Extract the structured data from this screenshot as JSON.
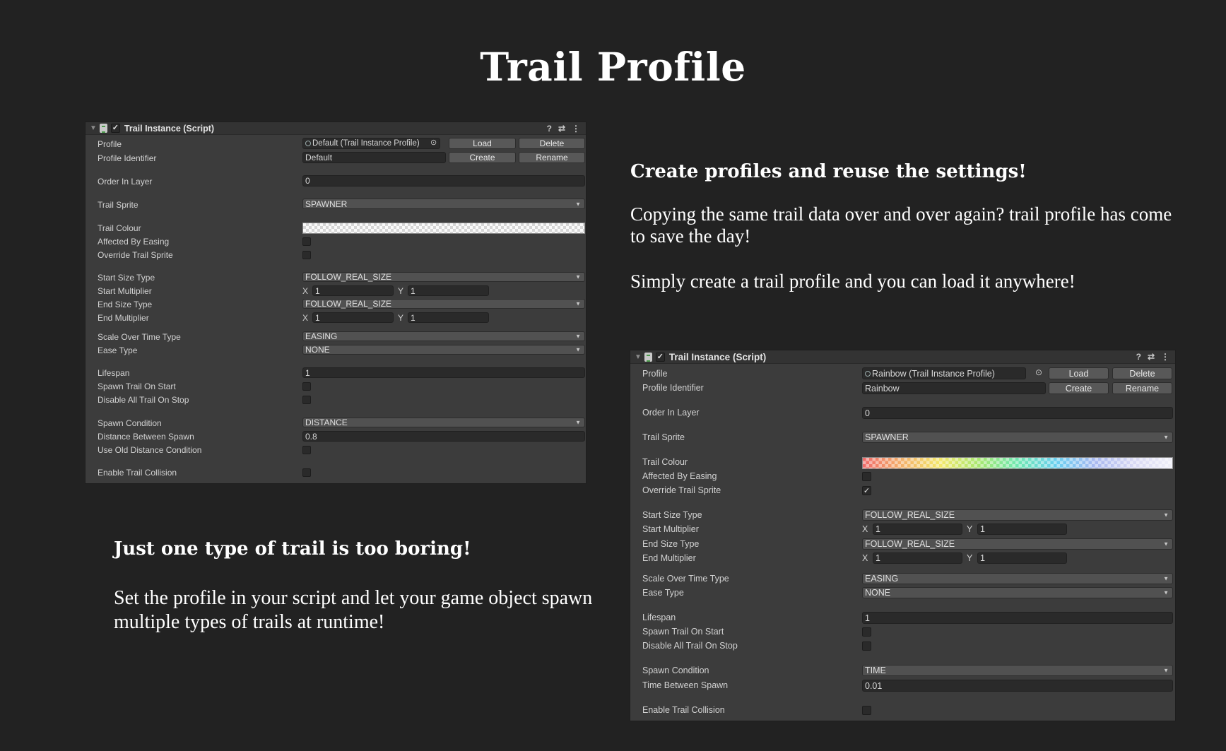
{
  "page": {
    "title": "Trail Profile",
    "section1": {
      "heading": "Create profiles and reuse the settings!",
      "para1": "Copying the same trail data over and over again? trail profile has come to save the day!",
      "para2": "Simply create a trail profile and you can load it anywhere!"
    },
    "section2": {
      "heading": "Just one type of trail is too boring!",
      "para1": "Set the profile in your script and let your game object spawn multiple types of trails at runtime!"
    }
  },
  "inspector1": {
    "header": "Trail Instance (Script)",
    "labels": {
      "profile": "Profile",
      "profile_identifier": "Profile Identifier",
      "order_in_layer": "Order In Layer",
      "trail_sprite": "Trail Sprite",
      "trail_colour": "Trail Colour",
      "affected_by_easing": "Affected By Easing",
      "override_trail_sprite": "Override Trail Sprite",
      "start_size_type": "Start Size Type",
      "start_multiplier": "Start Multiplier",
      "end_size_type": "End Size Type",
      "end_multiplier": "End Multiplier",
      "scale_over_time_type": "Scale Over Time Type",
      "ease_type": "Ease Type",
      "lifespan": "Lifespan",
      "spawn_trail_on_start": "Spawn Trail On Start",
      "disable_all_trail_on_stop": "Disable All Trail On Stop",
      "spawn_condition": "Spawn Condition",
      "spawn_distance_label": "Distance Between Spawn",
      "use_old_distance_condition": "Use Old Distance Condition",
      "enable_trail_collision": "Enable Trail Collision"
    },
    "values": {
      "profile": "Default (Trail Instance Profile)",
      "profile_identifier": "Default",
      "order_in_layer": "0",
      "trail_sprite": "SPAWNER",
      "start_size_type": "FOLLOW_REAL_SIZE",
      "start_x": "1",
      "start_y": "1",
      "end_size_type": "FOLLOW_REAL_SIZE",
      "end_x": "1",
      "end_y": "1",
      "scale_over_time_type": "EASING",
      "ease_type": "NONE",
      "lifespan": "1",
      "spawn_condition": "DISTANCE",
      "spawn_value": "0.8"
    },
    "checks": {
      "affected_by_easing": false,
      "override_trail_sprite": false,
      "spawn_trail_on_start": false,
      "disable_all_trail_on_stop": false,
      "use_old_distance_condition": false,
      "enable_trail_collision": false
    }
  },
  "inspector2": {
    "header": "Trail Instance (Script)",
    "labels": {
      "profile": "Profile",
      "profile_identifier": "Profile Identifier",
      "order_in_layer": "Order In Layer",
      "trail_sprite": "Trail Sprite",
      "trail_colour": "Trail Colour",
      "affected_by_easing": "Affected By Easing",
      "override_trail_sprite": "Override Trail Sprite",
      "start_size_type": "Start Size Type",
      "start_multiplier": "Start Multiplier",
      "end_size_type": "End Size Type",
      "end_multiplier": "End Multiplier",
      "scale_over_time_type": "Scale Over Time Type",
      "ease_type": "Ease Type",
      "lifespan": "Lifespan",
      "spawn_trail_on_start": "Spawn Trail On Start",
      "disable_all_trail_on_stop": "Disable All Trail On Stop",
      "spawn_condition": "Spawn Condition",
      "spawn_time_label": "Time Between Spawn",
      "enable_trail_collision": "Enable Trail Collision"
    },
    "values": {
      "profile": "Rainbow (Trail Instance Profile)",
      "profile_identifier": "Rainbow",
      "order_in_layer": "0",
      "trail_sprite": "SPAWNER",
      "start_size_type": "FOLLOW_REAL_SIZE",
      "start_x": "1",
      "start_y": "1",
      "end_size_type": "FOLLOW_REAL_SIZE",
      "end_x": "1",
      "end_y": "1",
      "scale_over_time_type": "EASING",
      "ease_type": "NONE",
      "lifespan": "1",
      "spawn_condition": "TIME",
      "spawn_value": "0.01"
    },
    "checks": {
      "affected_by_easing": false,
      "override_trail_sprite": true,
      "spawn_trail_on_start": false,
      "disable_all_trail_on_stop": false,
      "enable_trail_collision": false
    }
  },
  "buttons": {
    "load": "Load",
    "delete": "Delete",
    "create": "Create",
    "rename": "Rename"
  },
  "axis": {
    "x": "X",
    "y": "Y"
  },
  "icons": {
    "help": "?",
    "presets": "⇄",
    "more": "⋮",
    "foldout": "▼",
    "check": "✓",
    "dropdown": "▼",
    "target": "⊙"
  },
  "colors": {
    "background": "#222222",
    "panel": "#3c3c3c",
    "field": "#2a2a2a",
    "dropdown": "#515151",
    "button": "#585858"
  }
}
